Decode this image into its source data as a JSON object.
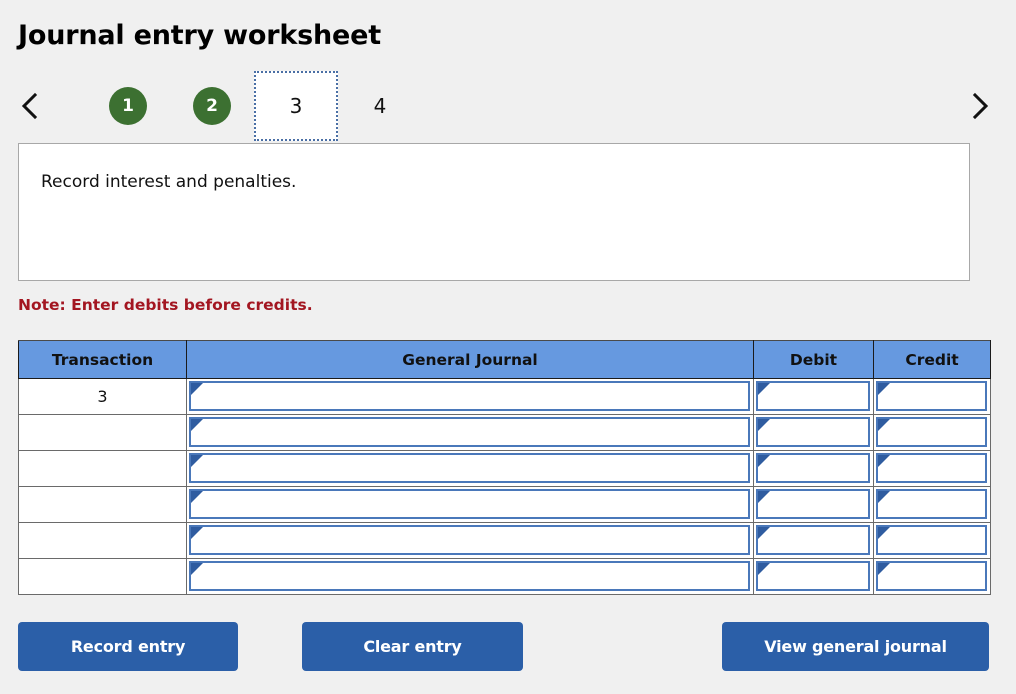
{
  "header": {
    "title": "Journal entry worksheet"
  },
  "nav": {
    "prev_icon": "chevron-left-icon",
    "next_icon": "chevron-right-icon",
    "tabs": [
      {
        "label": "1",
        "state": "done"
      },
      {
        "label": "2",
        "state": "done"
      },
      {
        "label": "3",
        "state": "current"
      },
      {
        "label": "4",
        "state": "pending"
      }
    ]
  },
  "description": {
    "text": "Record interest and penalties."
  },
  "note": {
    "text": "Note: Enter debits before credits."
  },
  "table": {
    "columns": [
      "Transaction",
      "General Journal",
      "Debit",
      "Credit"
    ],
    "rows": [
      {
        "transaction": "3",
        "general_journal": "",
        "debit": "",
        "credit": ""
      },
      {
        "transaction": "",
        "general_journal": "",
        "debit": "",
        "credit": ""
      },
      {
        "transaction": "",
        "general_journal": "",
        "debit": "",
        "credit": ""
      },
      {
        "transaction": "",
        "general_journal": "",
        "debit": "",
        "credit": ""
      },
      {
        "transaction": "",
        "general_journal": "",
        "debit": "",
        "credit": ""
      },
      {
        "transaction": "",
        "general_journal": "",
        "debit": "",
        "credit": ""
      }
    ]
  },
  "buttons": {
    "record": "Record entry",
    "clear": "Clear entry",
    "view": "View general journal"
  },
  "colors": {
    "page_background": "#f0f0f0",
    "table_header": "#6699e0",
    "tab_done": "#3c7031",
    "tab_current_border": "#4a6fa5",
    "note_text": "#a31621",
    "button": "#2b5fa8",
    "cell_border": "#4a78ba"
  }
}
